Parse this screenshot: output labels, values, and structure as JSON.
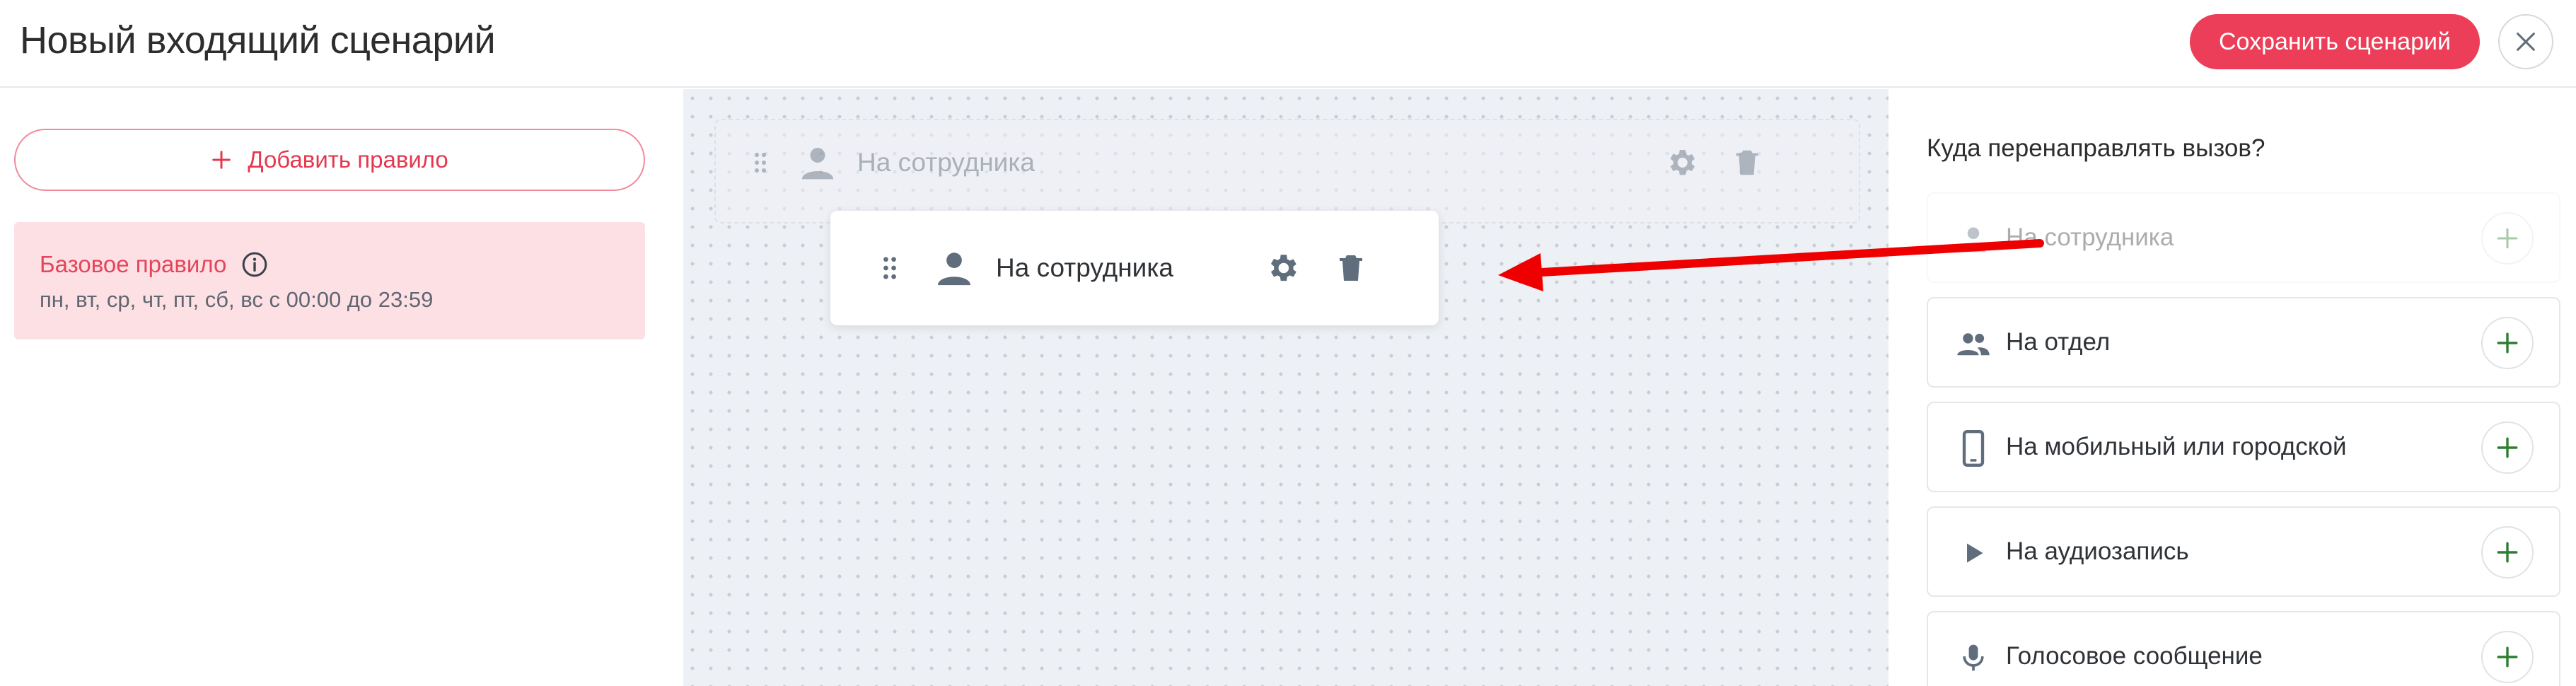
{
  "header": {
    "title": "Новый входящий сценарий",
    "save_label": "Сохранить сценарий",
    "close_icon": "close-icon"
  },
  "left_panel": {
    "add_rule_label": "Добавить правило",
    "rule": {
      "title": "Базовое правило",
      "schedule": "пн, вт, ср, чт, пт, сб, вс с 00:00 до 23:59"
    }
  },
  "canvas": {
    "ghost_node_label": "На сотрудника",
    "node_label": "На сотрудника"
  },
  "right_panel": {
    "question": "Куда перенаправлять вызов?",
    "options": [
      {
        "label": "На сотрудника",
        "icon": "person-icon",
        "enabled": false
      },
      {
        "label": "На отдел",
        "icon": "group-icon",
        "enabled": true
      },
      {
        "label": "На мобильный или городской",
        "icon": "smartphone-icon",
        "enabled": true
      },
      {
        "label": "На аудиозапись",
        "icon": "play-icon",
        "enabled": true
      },
      {
        "label": "Голосовое сообщение",
        "icon": "microphone-icon",
        "enabled": true
      }
    ]
  },
  "colors": {
    "accent": "#ec3e58",
    "rule_bg": "#fde0e4",
    "plus_green": "#2e7d32",
    "icon_gray": "#5f6d7c",
    "arrow": "#ee0000"
  }
}
